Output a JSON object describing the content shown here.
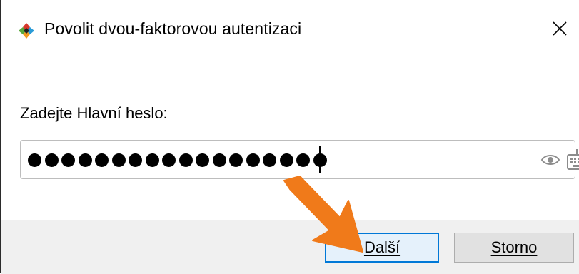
{
  "window": {
    "title": "Povolit dvou-faktorovou autentizaci"
  },
  "form": {
    "prompt": "Zadejte Hlavní heslo:",
    "password_dot_count": 18
  },
  "buttons": {
    "next_label": "Další",
    "cancel_label": "Storno"
  },
  "colors": {
    "focus_border": "#0078d7",
    "annotation_arrow": "#f07a1a",
    "footer_bg": "#f0f0f0"
  },
  "icons": [
    "app-icon",
    "close-icon",
    "show-password-eye-icon",
    "virtual-keyboard-icon",
    "annotation-arrow"
  ]
}
